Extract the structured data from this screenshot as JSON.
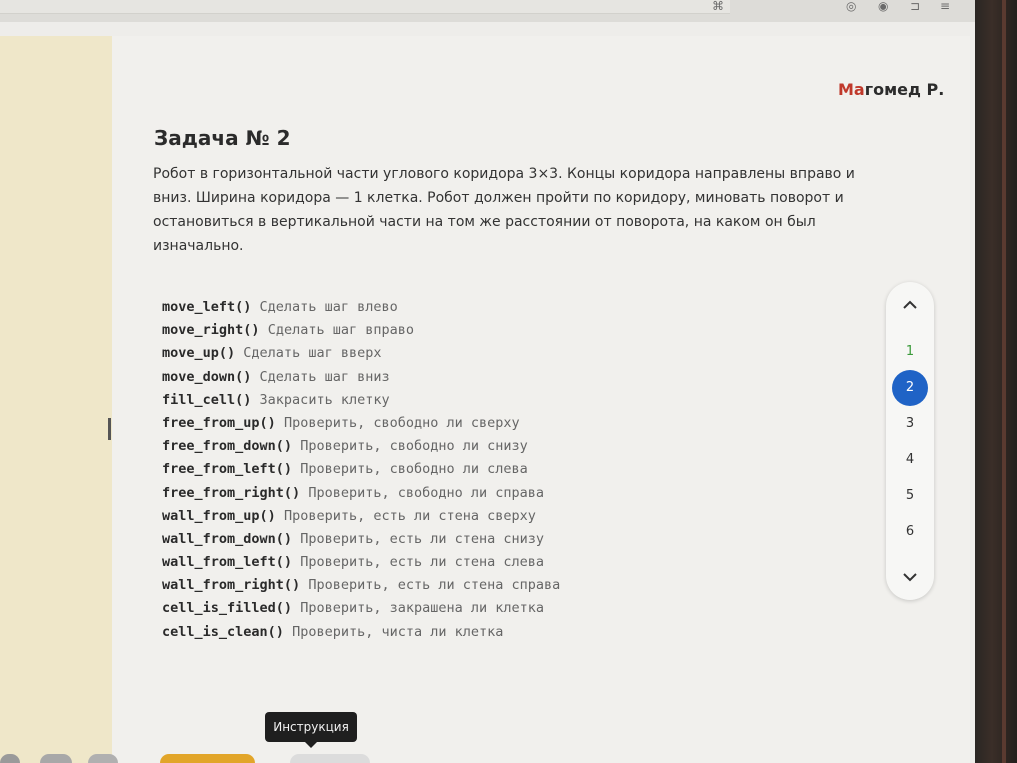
{
  "header": {
    "user_name_accent": "Ма",
    "user_name_rest": "гомед Р."
  },
  "task": {
    "title": "Задача № 2",
    "description": "Робот в горизонтальной части углового коридора 3×3. Концы коридора направлены вправо и вниз. Ширина коридора — 1 клетка. Робот должен пройти по коридору, миновать поворот и остановиться в вертикальной части на том же расстоянии от поворота, на каком он был изначально."
  },
  "commands": [
    {
      "name": "move_left()",
      "desc": "Сделать шаг влево"
    },
    {
      "name": "move_right()",
      "desc": "Сделать шаг вправо"
    },
    {
      "name": "move_up()",
      "desc": "Сделать шаг вверх"
    },
    {
      "name": "move_down()",
      "desc": "Сделать шаг вниз"
    },
    {
      "name": "fill_cell()",
      "desc": "Закрасить клетку"
    },
    {
      "name": "free_from_up()",
      "desc": "Проверить, свободно ли сверху"
    },
    {
      "name": "free_from_down()",
      "desc": "Проверить, свободно ли снизу"
    },
    {
      "name": "free_from_left()",
      "desc": "Проверить, свободно ли слева"
    },
    {
      "name": "free_from_right()",
      "desc": "Проверить, свободно ли справа"
    },
    {
      "name": "wall_from_up()",
      "desc": "Проверить, есть ли стена сверху"
    },
    {
      "name": "wall_from_down()",
      "desc": "Проверить, есть ли стена снизу"
    },
    {
      "name": "wall_from_left()",
      "desc": "Проверить, есть ли стена слева"
    },
    {
      "name": "wall_from_right()",
      "desc": "Проверить, есть ли стена справа"
    },
    {
      "name": "cell_is_filled()",
      "desc": "Проверить, закрашена ли клетка"
    },
    {
      "name": "cell_is_clean()",
      "desc": "Проверить, чиста ли клетка"
    }
  ],
  "pager": {
    "up_icon": "chevron-up-icon",
    "down_icon": "chevron-down-icon",
    "items": [
      "1",
      "2",
      "3",
      "4",
      "5",
      "6"
    ],
    "active": "2",
    "completed": [
      "1"
    ]
  },
  "tooltip": {
    "text": "Инструкция"
  },
  "colors": {
    "accent_red": "#c0392b",
    "active_blue": "#1f63c6",
    "done_green": "#3a9a3a"
  }
}
